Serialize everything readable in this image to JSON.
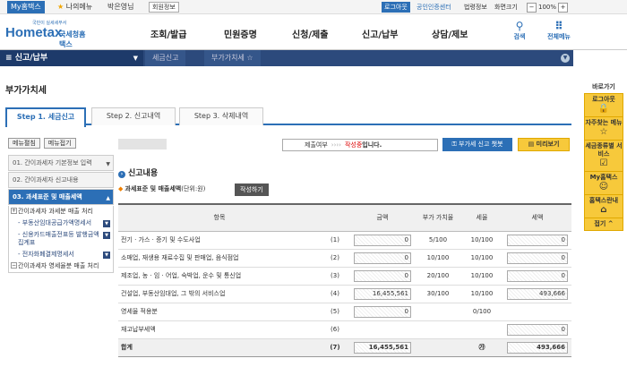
{
  "topbar": {
    "my_tab": "My홈택스",
    "favorite": "나의메뉴",
    "user": "박은영님",
    "user_info": "회원정보",
    "logout": "로그아웃",
    "cert_center": "공인인증센터",
    "law_info": "법령정보",
    "screen_menu": "화면크기",
    "zoom": "100%"
  },
  "header": {
    "logo_small": "국민이 실세세무서",
    "logo_main": "Hometax",
    "logo_kor": "국세청홈택스",
    "menu": [
      "조회/발급",
      "민원증명",
      "신청/제출",
      "신고/납부",
      "상담/제보"
    ],
    "search": "검색",
    "all_menu": "전체메뉴"
  },
  "navbar": {
    "main": "신고/납부",
    "crumb1": "세금신고",
    "crumb2": "부가가치세"
  },
  "page": {
    "title": "부가가치세"
  },
  "steps": [
    "Step 1. 세금신고",
    "Step 2. 신고내역",
    "Step 3. 삭제내역"
  ],
  "left": {
    "open": "메뉴펼침",
    "close": "메뉴접기",
    "items": [
      {
        "label": "01. 간이과세자 기본정보 입력",
        "state": "normal"
      },
      {
        "label": "02. 간이과세자 신고내용",
        "state": "normal"
      },
      {
        "label": "03. 과세표준 및 매출세액",
        "state": "active"
      }
    ],
    "subs": [
      {
        "label": "간이과세자 과세분 매출 처리",
        "pm": "+",
        "blue": false
      },
      {
        "label": "- 부동산임대공급가액명세서",
        "blue": true
      },
      {
        "label": "- 신용카드매출전표등 발행금액집계표",
        "blue": true
      },
      {
        "label": "- 전자화폐결제명세서",
        "blue": true
      },
      {
        "label": "간이과세자 영세율분 매출 처리",
        "pm": "-",
        "blue": false
      }
    ]
  },
  "status": {
    "label": "제출여부",
    "dots": "››››",
    "state": "작성중",
    "suffix": "입니다."
  },
  "buttons": {
    "guide": "부가세 신고 챗봇",
    "preview": "미리보기",
    "write": "작성하기"
  },
  "section": {
    "title": "신고내용",
    "subtitle": "과세표준 및 매출세액",
    "unit": "(단위:원)"
  },
  "table": {
    "headers": [
      "항목",
      "",
      "금액",
      "부가 가치율",
      "세율",
      "세액"
    ],
    "rows": [
      {
        "item": "전기 · 가스 · 증기 및 수도사업",
        "no": "(1)",
        "amount": "0",
        "rate1": "5/100",
        "rate2": "10/100",
        "tax": "0"
      },
      {
        "item": "소매업, 재생용 재료수집 및 판매업, 음식점업",
        "no": "(2)",
        "amount": "0",
        "rate1": "10/100",
        "rate2": "10/100",
        "tax": "0"
      },
      {
        "item": "제조업, 농 · 임 · 어업, 숙박업, 운수 및 통신업",
        "no": "(3)",
        "amount": "0",
        "rate1": "20/100",
        "rate2": "10/100",
        "tax": "0"
      },
      {
        "item": "건설업, 부동산임대업, 그 밖의 서비스업",
        "no": "(4)",
        "amount": "16,455,561",
        "rate1": "30/100",
        "rate2": "10/100",
        "tax": "493,666"
      },
      {
        "item": "영세율 적용분",
        "no": "(5)",
        "amount": "0",
        "rate1": "",
        "rate2": "0/100",
        "tax": ""
      },
      {
        "item": "재고납부세액",
        "no": "(6)",
        "amount": "",
        "rate1": "",
        "rate2": "",
        "tax": "0"
      },
      {
        "item": "합계",
        "no": "(7)",
        "amount": "16,455,561",
        "rate1": "",
        "rate2": "㉮",
        "tax": "493,666"
      }
    ]
  },
  "right": {
    "title": "바로가기",
    "items": [
      "로그아웃",
      "자주찾는 메뉴",
      "세금종류별 서비스",
      "My홈택스",
      "홈택스란내",
      "접기"
    ]
  }
}
